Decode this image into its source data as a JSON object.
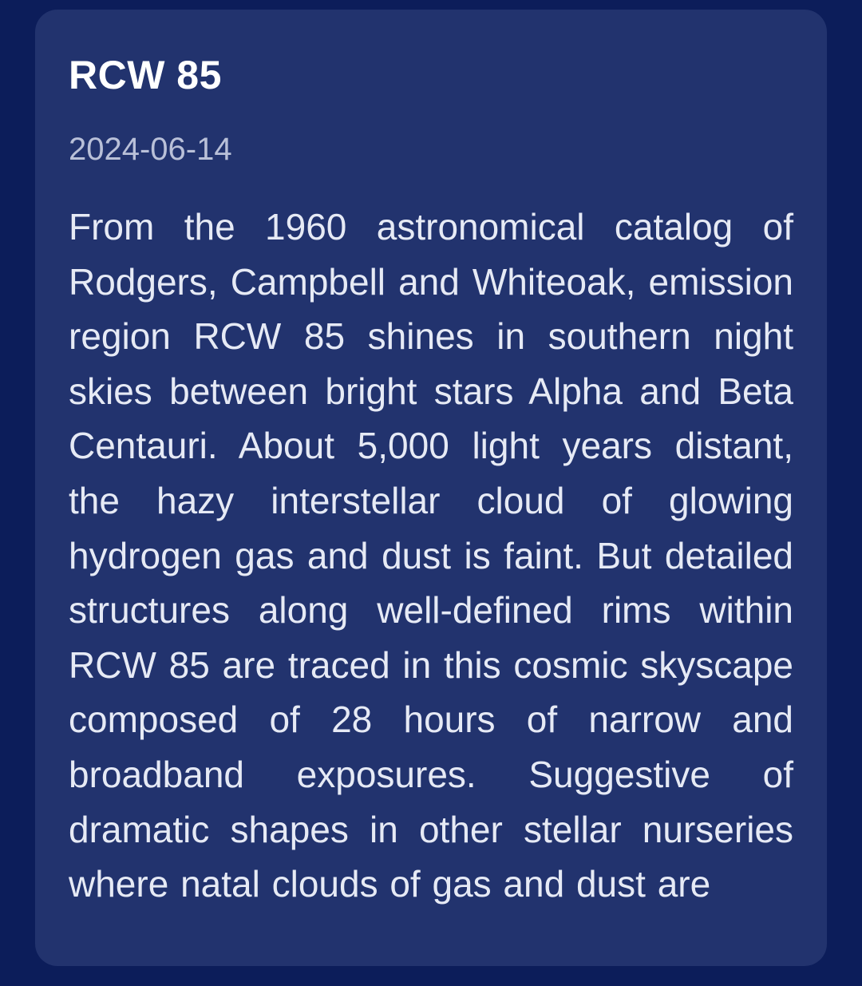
{
  "article": {
    "title": "RCW 85",
    "date": "2024-06-14",
    "body": "From the 1960 astronomical catalog of Rodgers, Campbell and Whiteoak, emission region RCW 85 shines in southern night skies between bright stars Alpha and Beta Centauri. About 5,000 light years distant, the hazy interstellar cloud of glowing hydrogen gas and dust is faint. But detailed structures along well-defined rims within RCW 85 are traced in this cosmic skyscape composed of 28 hours of narrow and broadband exposures. Suggestive of dramatic shapes in other stellar nurseries where natal clouds of gas and dust are"
  },
  "colors": {
    "page_background": "#0c1d5a",
    "card_background": "#22336e",
    "title_text": "#ffffff",
    "date_text": "#b9c0d8",
    "body_text": "#e6eaf5"
  }
}
